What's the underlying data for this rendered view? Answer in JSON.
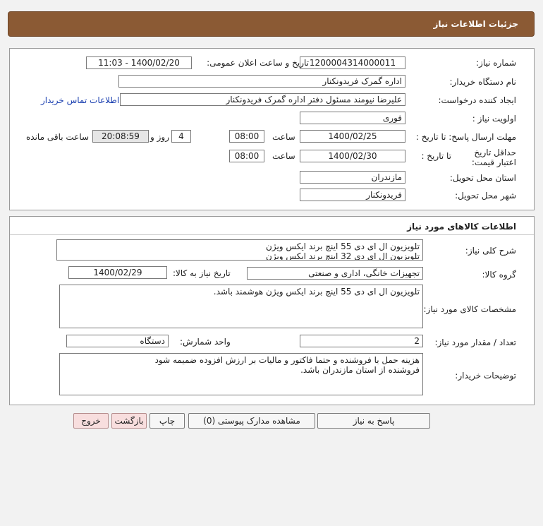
{
  "header": {
    "title": "جزئیات اطلاعات نیاز"
  },
  "info": {
    "need_number_label": "شماره نیاز:",
    "need_number": "1200004314000011",
    "announce_label": "تاریخ و ساعت اعلان عمومی:",
    "announce_value": "1400/02/20 - 11:03",
    "buyer_org_label": "نام دستگاه خریدار:",
    "buyer_org": "اداره گمرک فریدونکنار",
    "creator_label": "ایجاد کننده درخواست:",
    "creator": "علیرضا نیومند مسئول دفتر اداره گمرک فریدونکنار",
    "contact_link": "اطلاعات تماس خریدار",
    "priority_label": "اولویت نیاز :",
    "priority": "فوری",
    "deadline_label": "مهلت ارسال پاسخ: تا تاریخ :",
    "deadline_date": "1400/02/25",
    "time_label": "ساعت",
    "deadline_time": "08:00",
    "days": "4",
    "days_label": "روز و",
    "remaining": "20:08:59",
    "remaining_label": "ساعت باقی مانده",
    "validity_label": "حداقل تاریخ اعتبار قیمت:",
    "validity_to_label": "تا تاریخ :",
    "validity_date": "1400/02/30",
    "validity_time": "08:00",
    "province_label": "استان محل تحویل:",
    "province": "مازندران",
    "city_label": "شهر محل تحویل:",
    "city": "فریدونکنار"
  },
  "goods": {
    "section_title": "اطلاعات کالاهای مورد نیاز",
    "desc_label": "شرح کلی نیاز:",
    "desc_line1": "تلویزیون ال ای دی 55 اینچ برند ایکس ویژن",
    "desc_line2": "تلویزیون ال ای دی  32 اینچ برند ایکس ویژن",
    "group_label": "گروه کالا:",
    "group": "تجهیزات خانگی، اداری و صنعتی",
    "need_date_label": "تاریخ نیاز به کالا:",
    "need_date": "1400/02/29",
    "spec_label": "مشخصات کالای مورد نیاز:",
    "spec": "تلویزیون ال ای دی 55 اینچ برند ایکس ویژن هوشمند باشد.",
    "qty_label": "تعداد / مقدار مورد نیاز:",
    "qty": "2",
    "unit_label": "واحد شمارش:",
    "unit": "دستگاه",
    "notes_label": "توضیحات خریدار:",
    "notes_line1": "هزینه حمل با فروشنده و حتما  فاکتور و  مالیات بر ارزش افزوده ضمیمه شود",
    "notes_line2": "فروشنده از استان مازندران باشد."
  },
  "buttons": {
    "reply": "پاسخ به نیاز",
    "attachments": "مشاهده مدارک پیوستی (0)",
    "print": "چاپ",
    "back": "بازگشت",
    "exit": "خروج"
  }
}
